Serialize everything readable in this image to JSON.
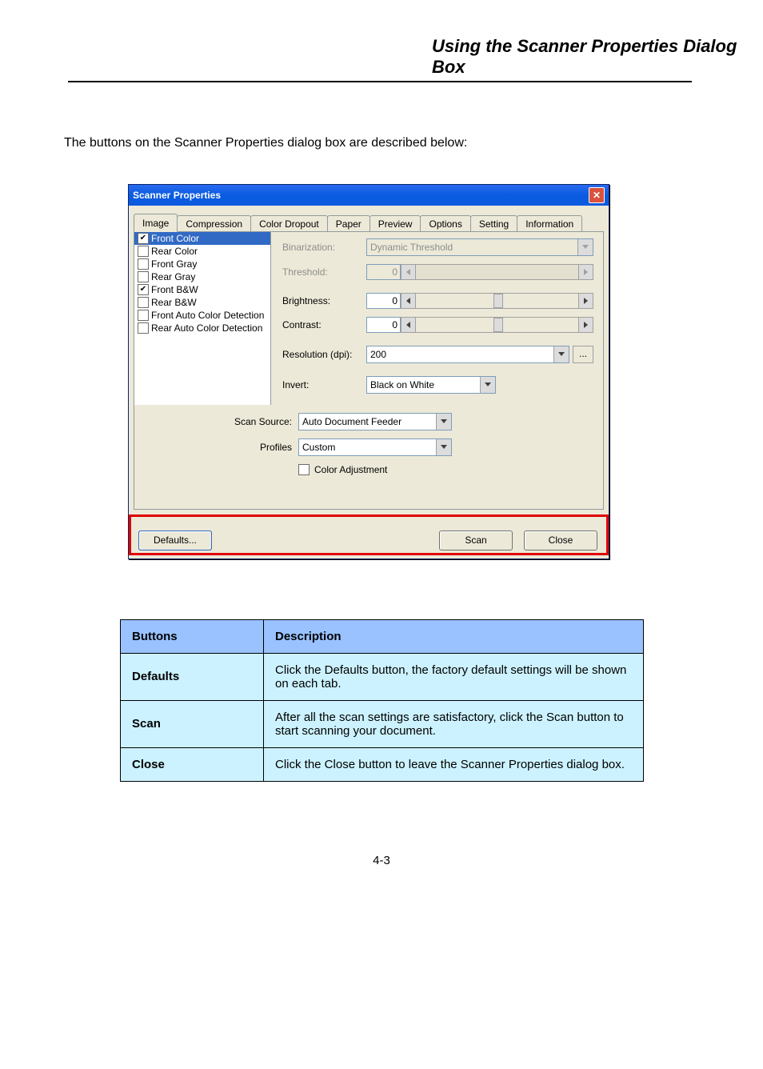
{
  "header": {
    "chapter": "Using the Scanner Properties Dialog Box"
  },
  "intro": "The buttons on the Scanner Properties dialog box are described below:",
  "dialog": {
    "title": "Scanner Properties",
    "tabs": [
      "Image",
      "Compression",
      "Color Dropout",
      "Paper",
      "Preview",
      "Options",
      "Setting",
      "Information"
    ],
    "activeTab": 0,
    "imageList": [
      {
        "label": "Front Color",
        "checked": true,
        "selected": true
      },
      {
        "label": "Rear Color",
        "checked": false
      },
      {
        "label": "Front Gray",
        "checked": false
      },
      {
        "label": "Rear Gray",
        "checked": false
      },
      {
        "label": "Front B&W",
        "checked": true
      },
      {
        "label": "Rear B&W",
        "checked": false
      },
      {
        "label": "Front Auto Color Detection",
        "checked": false
      },
      {
        "label": "Rear Auto Color Detection",
        "checked": false
      }
    ],
    "fields": {
      "binarization": {
        "label": "Binarization:",
        "value": "Dynamic Threshold",
        "disabled": true
      },
      "threshold": {
        "label": "Threshold:",
        "value": "0",
        "disabled": true
      },
      "brightness": {
        "label": "Brightness:",
        "value": "0"
      },
      "contrast": {
        "label": "Contrast:",
        "value": "0"
      },
      "resolution": {
        "label": "Resolution (dpi):",
        "value": "200"
      },
      "invert": {
        "label": "Invert:",
        "value": "Black on White"
      },
      "more": "...",
      "scanSource": {
        "label": "Scan Source:",
        "value": "Auto Document Feeder"
      },
      "profiles": {
        "label": "Profiles",
        "value": "Custom"
      },
      "colorAdj": {
        "label": "Color Adjustment",
        "checked": false
      }
    },
    "buttons": {
      "defaults": "Defaults...",
      "scan": "Scan",
      "close": "Close"
    }
  },
  "table": {
    "headers": [
      "Buttons",
      "Description"
    ],
    "rows": [
      {
        "btn": "Defaults",
        "desc": "Click the Defaults button, the factory default settings will be shown on each tab."
      },
      {
        "btn": "Scan",
        "desc": "After all the scan settings are satisfactory, click the Scan button to start scanning your document."
      },
      {
        "btn": "Close",
        "desc": "Click the Close button to leave the Scanner Properties dialog box."
      }
    ]
  },
  "pagenum": "4-3"
}
